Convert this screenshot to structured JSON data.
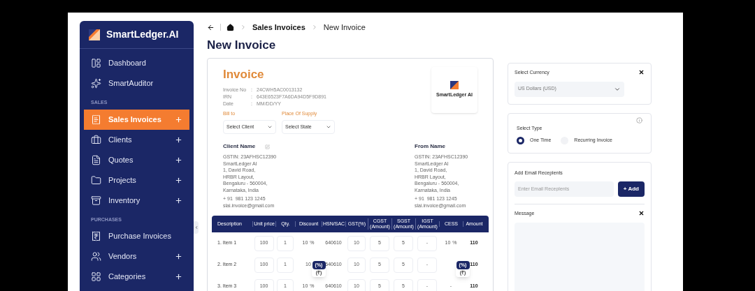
{
  "sidebar": {
    "brand": "SmartLedger.AI",
    "items": [
      {
        "kind": "item",
        "label": "Dashboard",
        "selected": false,
        "has_add": false
      },
      {
        "kind": "item",
        "label": "SmartAuditor",
        "selected": false,
        "has_add": false
      },
      {
        "kind": "section",
        "label": "SALES"
      },
      {
        "kind": "item",
        "label": "Sales Invoices",
        "selected": true,
        "has_add": true
      },
      {
        "kind": "item",
        "label": "Clients",
        "selected": false,
        "has_add": true
      },
      {
        "kind": "item",
        "label": "Quotes",
        "selected": false,
        "has_add": true
      },
      {
        "kind": "item",
        "label": "Projects",
        "selected": false,
        "has_add": true
      },
      {
        "kind": "item",
        "label": "Inventory",
        "selected": false,
        "has_add": true
      },
      {
        "kind": "section",
        "label": "PURCHASES"
      },
      {
        "kind": "item",
        "label": "Purchase Invoices",
        "selected": false,
        "has_add": false
      },
      {
        "kind": "item",
        "label": "Vendors",
        "selected": false,
        "has_add": true
      },
      {
        "kind": "item",
        "label": "Categories",
        "selected": false,
        "has_add": true
      }
    ]
  },
  "breadcrumb": [
    "Sales Invoices",
    "New Invoice"
  ],
  "page_title": "New Invoice",
  "invoice": {
    "heading": "Invoice",
    "meta": [
      {
        "label": "Invoice No",
        "separator": ":",
        "value": "24CWH5AC0013132"
      },
      {
        "label": "IRN",
        "separator": ":",
        "value": "643E6523F7A6DA94D5F9D891"
      },
      {
        "label": "Date",
        "separator": ":",
        "value": "MM/DD/YY"
      }
    ],
    "logo_text": "SmartLedger AI",
    "selects": [
      {
        "label": "Bill to",
        "value": "Select Client"
      },
      {
        "label": "Place Of Supply",
        "value": "Select State"
      }
    ],
    "parties": [
      {
        "title": "Client Name",
        "editable": true,
        "lines": [
          "GSTIN: 23AFHSC12390",
          "SmartLedger AI",
          "1, David Road,",
          "HRBR Layout,",
          "Bengaluru - 560004,",
          "Karnataka, India"
        ],
        "phone": "+ 91  981 123 1245",
        "email": "slai.invoice@gmail.com"
      },
      {
        "title": "From Name",
        "editable": false,
        "lines": [
          "GSTIN: 23AFHSC12390",
          "SmartLedger AI",
          "1, David Road,",
          "HRBR Layout,",
          "Bengaluru - 560004,",
          "Karnataka, India"
        ],
        "phone": "+ 91  981 123 1245",
        "email": "slai.invoice@gmail.com"
      }
    ],
    "table": {
      "columns": [
        "Description",
        "Unit price",
        "Qty.",
        "Discount",
        "HSN/SAC",
        "GST(%)",
        "CGST (Amount)",
        "SGST (Amount)",
        "IGST (Amount)",
        "CESS",
        "Amount"
      ],
      "rows": [
        {
          "description": "1. Item 1",
          "unit_price": "100",
          "qty": "1",
          "discount": "10",
          "discount_unit": "%",
          "hsn": "640610",
          "gst": "10",
          "cgst": "5",
          "sgst": "5",
          "igst": "-",
          "cess": "10",
          "cess_unit": "%",
          "amount": "110"
        },
        {
          "description": "2. Item 2",
          "unit_price": "100",
          "qty": "1",
          "discount": "10",
          "discount_menu": [
            "(%)",
            "(₹)"
          ],
          "hsn": "640610",
          "gst": "10",
          "cgst": "5",
          "sgst": "5",
          "igst": "-",
          "cess_menu": [
            "(%)",
            "(₹)"
          ],
          "amount": "110"
        },
        {
          "description": "3. Item 3",
          "unit_price": "100",
          "qty": "1",
          "discount": "10",
          "discount_unit": "%",
          "hsn": "640610",
          "gst": "10",
          "cgst": "5",
          "sgst": "5",
          "igst": "-",
          "cess": "-",
          "amount": "110"
        }
      ]
    }
  },
  "currency": {
    "label": "Select Currency",
    "value": "US Dollars (USD)"
  },
  "type": {
    "label": "Select Type",
    "options": [
      {
        "label": "One Time",
        "selected": true
      },
      {
        "label": "Recurring Invoice",
        "selected": false
      }
    ]
  },
  "email": {
    "label": "Add Email Receplents",
    "placeholder": "Enter Email Receplents",
    "button": "+ Add"
  },
  "message": {
    "label": "Message"
  }
}
